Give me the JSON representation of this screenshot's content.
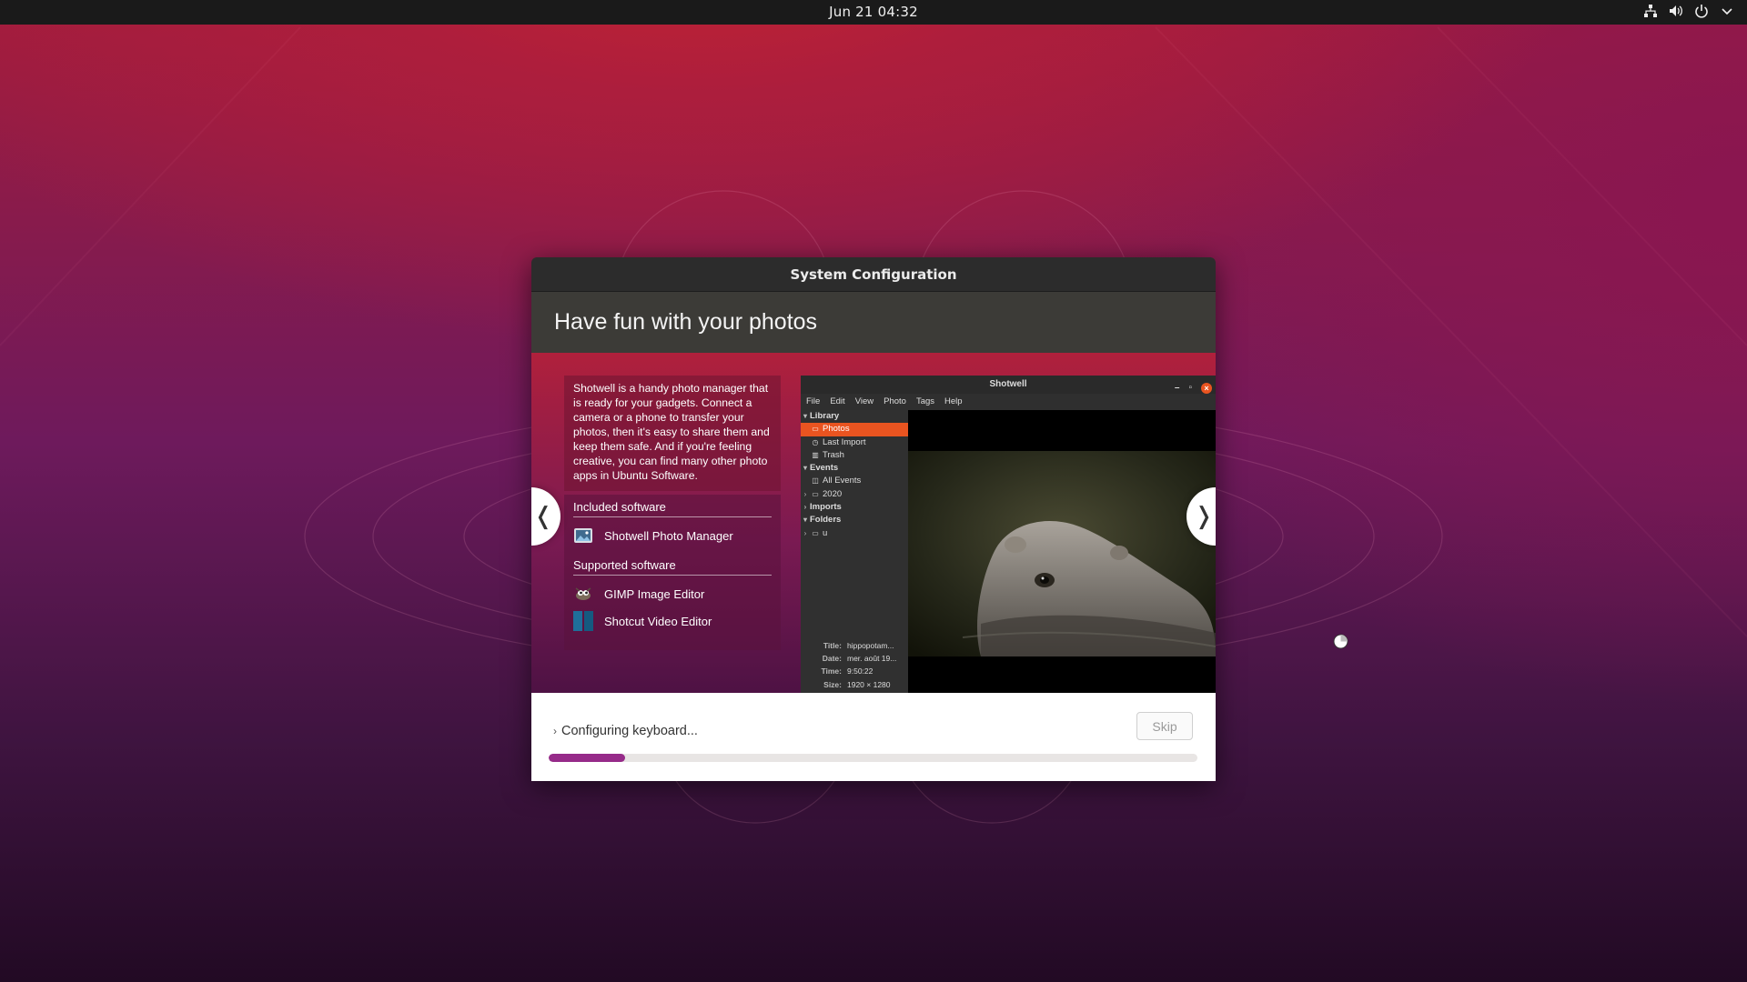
{
  "topbar": {
    "clock": "Jun 21  04:32",
    "tray_icons": [
      "network-icon",
      "volume-icon",
      "power-icon",
      "chevron-down-icon"
    ]
  },
  "dialog": {
    "title": "System Configuration",
    "slide_title": "Have fun with your photos",
    "description": "Shotwell is a handy photo manager that is ready for your gadgets. Connect a camera or a phone to transfer your photos, then it's easy to share them and keep them safe. And if you're feeling creative, you can find many other photo apps in Ubuntu Software.",
    "included_heading": "Included software",
    "included": [
      {
        "name": "Shotwell Photo Manager",
        "icon": "shotwell-icon"
      }
    ],
    "supported_heading": "Supported software",
    "supported": [
      {
        "name": "GIMP Image Editor",
        "icon": "gimp-icon"
      },
      {
        "name": "Shotcut Video Editor",
        "icon": "shotcut-icon"
      }
    ],
    "prev_glyph": "❬",
    "next_glyph": "❭"
  },
  "shotwell": {
    "title": "Shotwell",
    "menu": [
      "File",
      "Edit",
      "View",
      "Photo",
      "Tags",
      "Help"
    ],
    "tree": {
      "library": "Library",
      "photos": "Photos",
      "last_import": "Last Import",
      "trash": "Trash",
      "events": "Events",
      "all_events": "All Events",
      "year": "2020",
      "imports": "Imports",
      "folders": "Folders",
      "folder_u": "u"
    },
    "meta": [
      {
        "key": "Title:",
        "value": "hippopotam..."
      },
      {
        "key": "Date:",
        "value": "mer. août 19..."
      },
      {
        "key": "Time:",
        "value": "9:50:22"
      },
      {
        "key": "Size:",
        "value": "1920 × 1280"
      }
    ],
    "accent": "#e95420"
  },
  "progress": {
    "status": "Configuring keyboard...",
    "skip_label": "Skip",
    "fraction": 0.118,
    "color": "#962b89"
  }
}
